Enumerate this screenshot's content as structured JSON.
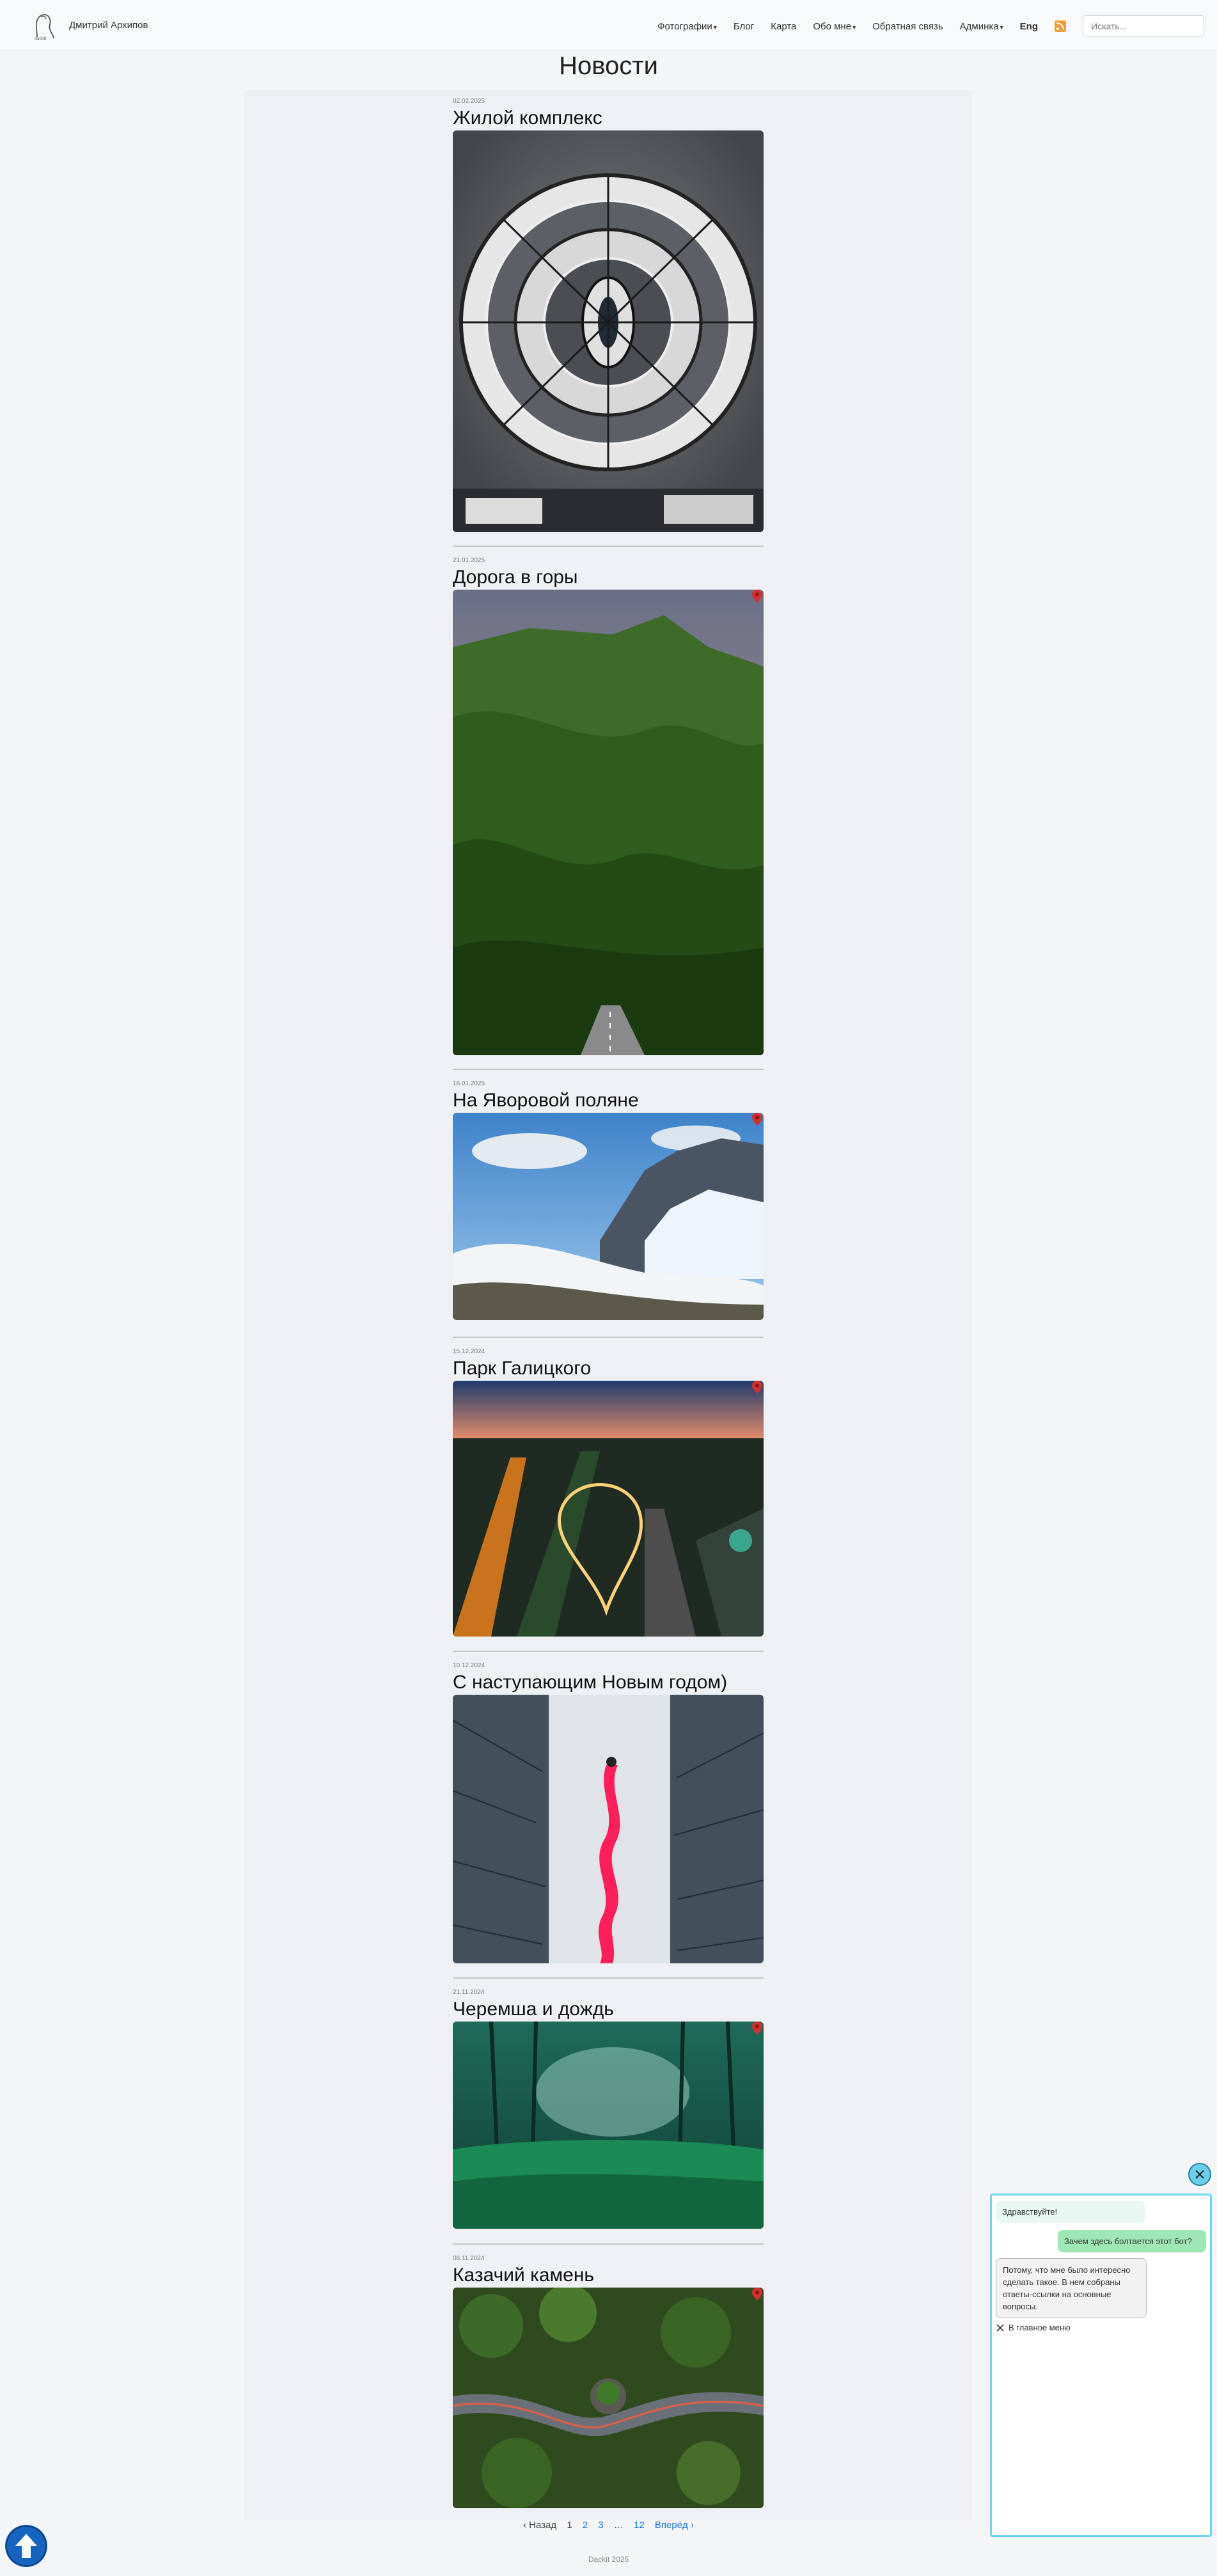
{
  "navbar": {
    "brand": "Дмитрий Архипов",
    "items": [
      {
        "label": "Фотографии",
        "dropdown": true
      },
      {
        "label": "Блог",
        "dropdown": false
      },
      {
        "label": "Карта",
        "dropdown": false
      },
      {
        "label": "Обо мне",
        "dropdown": true
      },
      {
        "label": "Обратная связь",
        "dropdown": false
      },
      {
        "label": "Админка",
        "dropdown": true
      }
    ],
    "lang": "Eng",
    "rss_icon": "rss-icon",
    "search_placeholder": "Искать..."
  },
  "page_title": "Новости",
  "posts": [
    {
      "date": "02.02.2025",
      "title": "Жилой комплекс",
      "map_pin": false
    },
    {
      "date": "21.01.2025",
      "title": "Дорога в горы",
      "map_pin": true
    },
    {
      "date": "16.01.2025",
      "title": "На Яворовой поляне",
      "map_pin": true
    },
    {
      "date": "15.12.2024",
      "title": "Парк Галицкого",
      "map_pin": true
    },
    {
      "date": "10.12.2024",
      "title": "С наступающим Новым годом)",
      "map_pin": false
    },
    {
      "date": "21.11.2024",
      "title": "Черемша и дождь",
      "map_pin": true
    },
    {
      "date": "08.11.2024",
      "title": "Казачий камень",
      "map_pin": true
    }
  ],
  "pagination": {
    "prev": "‹ Назад",
    "pages": [
      "1",
      "2",
      "3",
      "…",
      "12"
    ],
    "current": "1",
    "next": "Вперёд ›"
  },
  "footer": "Dackit 2025",
  "chat": {
    "messages": [
      {
        "from": "bot",
        "text": "Здравствуйте!"
      },
      {
        "from": "user",
        "text": "Зачем здесь болтается этот бот?"
      },
      {
        "from": "bot",
        "text": "Потому, что мне было интересно сделать такое. В нем собраны ответы-ссылки на основные вопросы."
      }
    ],
    "menu_label": "В главное меню"
  },
  "colors": {
    "accent": "#1a73e8",
    "chat_border": "#6ed6ee",
    "user_bubble": "#9ee6b3"
  }
}
